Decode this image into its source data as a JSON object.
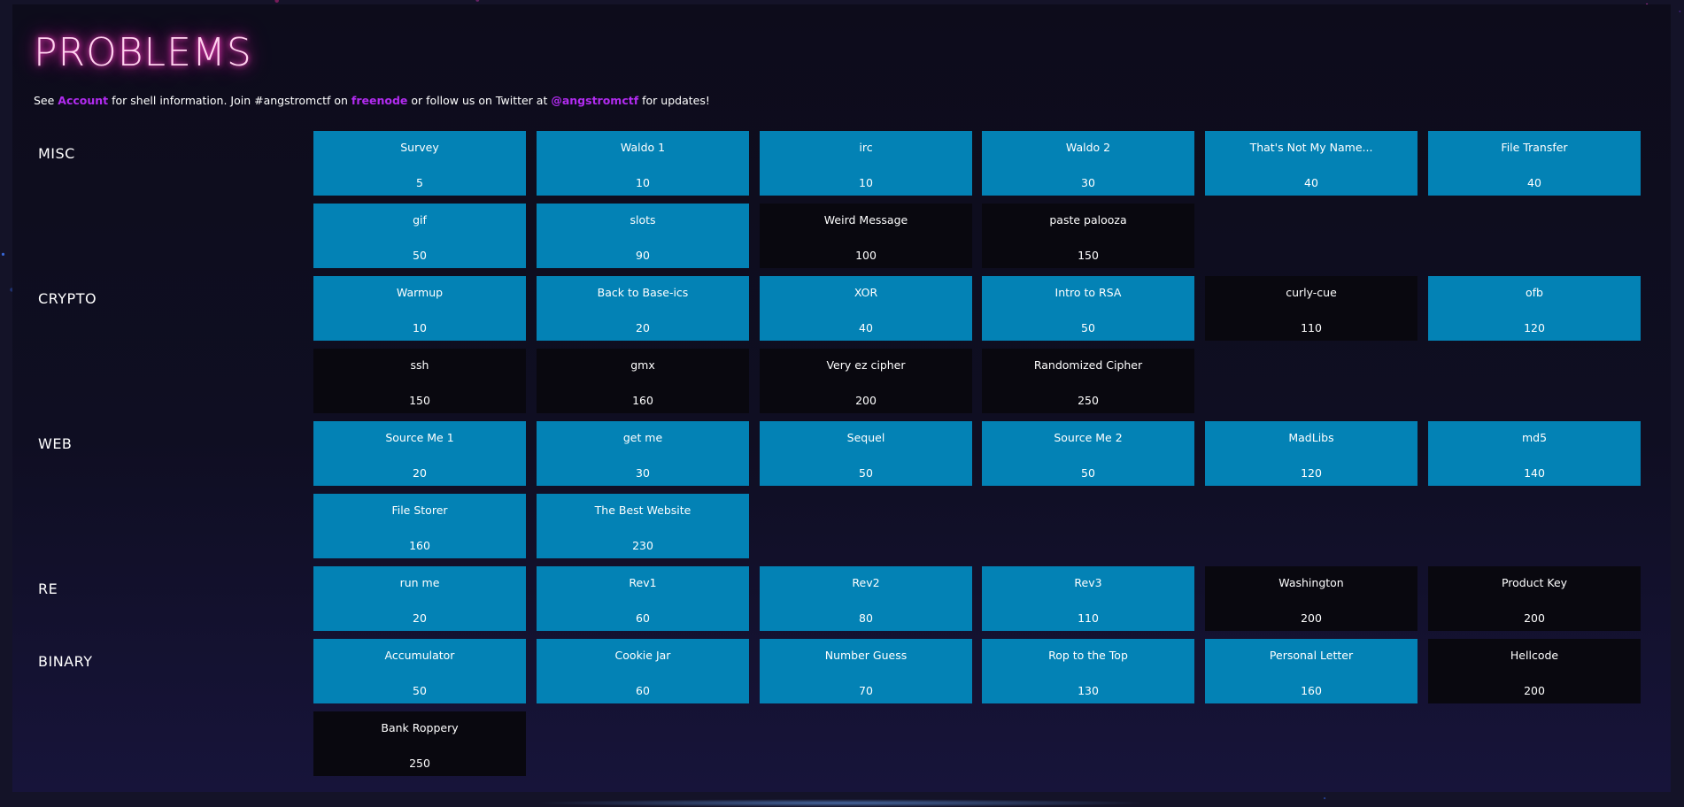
{
  "page": {
    "title": "PROBLEMS",
    "intro": {
      "prefix": "See ",
      "account_link": "Account",
      "middle": " for shell information. Join #angstromctf on ",
      "freenode_link": "freenode",
      "middle2": " or follow us on Twitter at ",
      "twitter_link": "@angstromctf",
      "suffix": " for updates!"
    }
  },
  "colors": {
    "solved_card": "#0382b5",
    "unsolved_card": "#09080f",
    "title_glow": "#ff2fbf",
    "link": "#b22bf0"
  },
  "categories": [
    {
      "label": "MISC",
      "problems": [
        {
          "name": "Survey",
          "points": "5",
          "solved": true
        },
        {
          "name": "Waldo 1",
          "points": "10",
          "solved": true
        },
        {
          "name": "irc",
          "points": "10",
          "solved": true
        },
        {
          "name": "Waldo 2",
          "points": "30",
          "solved": true
        },
        {
          "name": "That's Not My Name...",
          "points": "40",
          "solved": true
        },
        {
          "name": "File Transfer",
          "points": "40",
          "solved": true
        },
        {
          "name": "gif",
          "points": "50",
          "solved": true
        },
        {
          "name": "slots",
          "points": "90",
          "solved": true
        },
        {
          "name": "Weird Message",
          "points": "100",
          "solved": false
        },
        {
          "name": "paste palooza",
          "points": "150",
          "solved": false
        }
      ]
    },
    {
      "label": "CRYPTO",
      "problems": [
        {
          "name": "Warmup",
          "points": "10",
          "solved": true
        },
        {
          "name": "Back to Base-ics",
          "points": "20",
          "solved": true
        },
        {
          "name": "XOR",
          "points": "40",
          "solved": true
        },
        {
          "name": "Intro to RSA",
          "points": "50",
          "solved": true
        },
        {
          "name": "curly-cue",
          "points": "110",
          "solved": false
        },
        {
          "name": "ofb",
          "points": "120",
          "solved": true
        },
        {
          "name": "ssh",
          "points": "150",
          "solved": false
        },
        {
          "name": "gmx",
          "points": "160",
          "solved": false
        },
        {
          "name": "Very ez cipher",
          "points": "200",
          "solved": false
        },
        {
          "name": "Randomized Cipher",
          "points": "250",
          "solved": false
        }
      ]
    },
    {
      "label": "WEB",
      "problems": [
        {
          "name": "Source Me 1",
          "points": "20",
          "solved": true
        },
        {
          "name": "get me",
          "points": "30",
          "solved": true
        },
        {
          "name": "Sequel",
          "points": "50",
          "solved": true
        },
        {
          "name": "Source Me 2",
          "points": "50",
          "solved": true
        },
        {
          "name": "MadLibs",
          "points": "120",
          "solved": true
        },
        {
          "name": "md5",
          "points": "140",
          "solved": true
        },
        {
          "name": "File Storer",
          "points": "160",
          "solved": true
        },
        {
          "name": "The Best Website",
          "points": "230",
          "solved": true
        }
      ]
    },
    {
      "label": "RE",
      "problems": [
        {
          "name": "run me",
          "points": "20",
          "solved": true
        },
        {
          "name": "Rev1",
          "points": "60",
          "solved": true
        },
        {
          "name": "Rev2",
          "points": "80",
          "solved": true
        },
        {
          "name": "Rev3",
          "points": "110",
          "solved": true
        },
        {
          "name": "Washington",
          "points": "200",
          "solved": false
        },
        {
          "name": "Product Key",
          "points": "200",
          "solved": false
        }
      ]
    },
    {
      "label": "BINARY",
      "problems": [
        {
          "name": "Accumulator",
          "points": "50",
          "solved": true
        },
        {
          "name": "Cookie Jar",
          "points": "60",
          "solved": true
        },
        {
          "name": "Number Guess",
          "points": "70",
          "solved": true
        },
        {
          "name": "Rop to the Top",
          "points": "130",
          "solved": true
        },
        {
          "name": "Personal Letter",
          "points": "160",
          "solved": true
        },
        {
          "name": "Hellcode",
          "points": "200",
          "solved": false
        },
        {
          "name": "Bank Roppery",
          "points": "250",
          "solved": false
        }
      ]
    }
  ]
}
